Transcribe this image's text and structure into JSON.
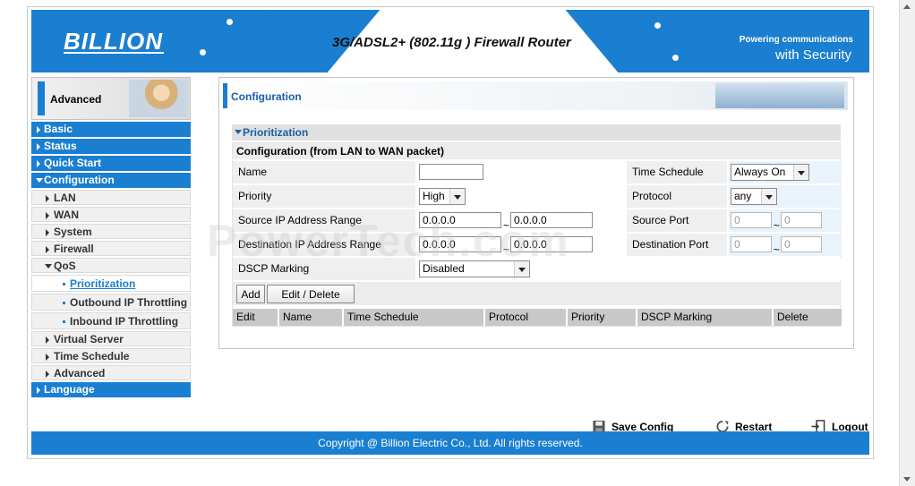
{
  "header": {
    "logo": "BILLION",
    "product_title": "3G/ADSL2+ (802.11g ) Firewall Router",
    "tagline_line1": "Powering communications",
    "tagline_line2": "with Security"
  },
  "sidebar": {
    "section_label": "Advanced",
    "items": [
      {
        "label": "Basic"
      },
      {
        "label": "Status"
      },
      {
        "label": "Quick Start"
      },
      {
        "label": "Configuration"
      },
      {
        "label": "LAN"
      },
      {
        "label": "WAN"
      },
      {
        "label": "System"
      },
      {
        "label": "Firewall"
      },
      {
        "label": "QoS"
      },
      {
        "label": "Prioritization"
      },
      {
        "label": "Outbound IP Throttling"
      },
      {
        "label": "Inbound IP Throttling"
      },
      {
        "label": "Virtual Server"
      },
      {
        "label": "Time Schedule"
      },
      {
        "label": "Advanced"
      },
      {
        "label": "Language"
      }
    ]
  },
  "content": {
    "title": "Configuration",
    "section": "Prioritization",
    "subheader": "Configuration (from LAN to WAN packet)",
    "fields": {
      "name_label": "Name",
      "name_value": "",
      "time_schedule_label": "Time Schedule",
      "time_schedule_value": "Always On",
      "priority_label": "Priority",
      "priority_value": "High",
      "protocol_label": "Protocol",
      "protocol_value": "any",
      "src_ip_label": "Source IP Address Range",
      "src_ip_from": "0.0.0.0",
      "src_ip_to": "0.0.0.0",
      "src_port_label": "Source Port",
      "src_port_from": "0",
      "src_port_to": "0",
      "dst_ip_label": "Destination IP Address Range",
      "dst_ip_from": "0.0.0.0",
      "dst_ip_to": "0.0.0.0",
      "dst_port_label": "Destination Port",
      "dst_port_from": "0",
      "dst_port_to": "0",
      "dscp_label": "DSCP Marking",
      "dscp_value": "Disabled",
      "tilde": "~"
    },
    "buttons": {
      "add": "Add",
      "edit_delete": "Edit / Delete"
    },
    "table_headers": [
      "Edit",
      "Name",
      "Time Schedule",
      "Protocol",
      "Priority",
      "DSCP Marking",
      "Delete"
    ]
  },
  "footer": {
    "save_config": "Save Config",
    "restart": "Restart",
    "logout": "Logout",
    "copyright": "Copyright @ Billion Electric Co., Ltd. All rights reserved."
  },
  "watermark": "PowerTech.com",
  "colors": {
    "brand_blue": "#1a7fd0",
    "row_grey": "#efefef",
    "header_grey": "#c8c8c8"
  }
}
